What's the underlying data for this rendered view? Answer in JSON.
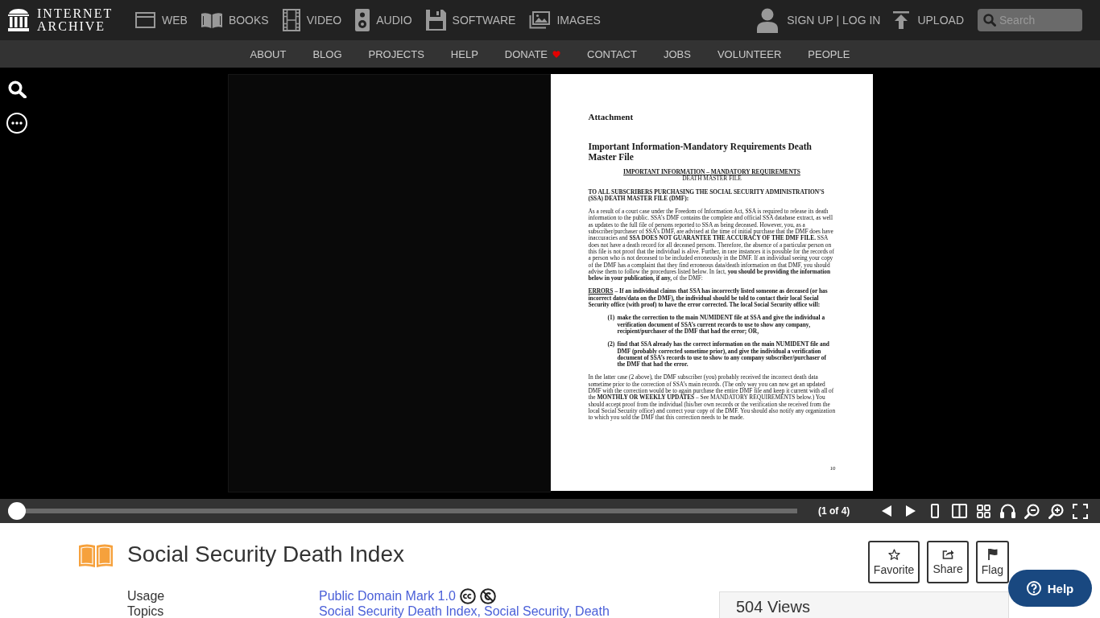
{
  "header": {
    "logo": "INTERNET ARCHIVE",
    "media": [
      {
        "kind": "web",
        "label": "WEB"
      },
      {
        "kind": "books",
        "label": "BOOKS"
      },
      {
        "kind": "video",
        "label": "VIDEO"
      },
      {
        "kind": "audio",
        "label": "AUDIO"
      },
      {
        "kind": "software",
        "label": "SOFTWARE"
      },
      {
        "kind": "images",
        "label": "IMAGES"
      }
    ],
    "account": "SIGN UP | LOG IN",
    "upload": "UPLOAD",
    "search": {
      "placeholder": "Search"
    }
  },
  "subnav": [
    {
      "kind": "plain",
      "label": "ABOUT"
    },
    {
      "kind": "plain",
      "label": "BLOG"
    },
    {
      "kind": "plain",
      "label": "PROJECTS"
    },
    {
      "kind": "plain",
      "label": "HELP"
    },
    {
      "kind": "donate",
      "label": "DONATE"
    },
    {
      "kind": "plain",
      "label": "CONTACT"
    },
    {
      "kind": "plain",
      "label": "JOBS"
    },
    {
      "kind": "plain",
      "label": "VOLUNTEER"
    },
    {
      "kind": "plain",
      "label": "PEOPLE"
    }
  ],
  "viewer": {
    "document_page": {
      "blocks": [
        {
          "kind": "title",
          "text": "Attachment"
        },
        {
          "kind": "heading",
          "text": "Important Information-Mandatory Requirements Death Master File"
        },
        {
          "kind": "underlined",
          "text": "IMPORTANT INFORMATION – MANDATORY REQUIREMENTS"
        },
        {
          "kind": "centered",
          "text": "DEATH MASTER FILE"
        },
        {
          "kind": "bold",
          "text": "TO ALL SUBSCRIBERS PURCHASING THE SOCIAL SECURITY ADMINISTRATION’S (SSA) DEATH MASTER FILE (DMF):"
        },
        {
          "kind": "paragraph",
          "text": "As a result of a court case under the Freedom of Information Act, SSA is required to release its death information to the public. SSA’s DMF contains the complete and official SSA database extract, as well as updates to the full file of persons reported to SSA as being deceased. However, you, as a subscriber/purchaser of SSA’s DMF, are advised at the time of initial purchase that the DMF does have inaccuracies and **SSA DOES NOT GUARANTEE THE ACCURACY OF THE DMF FILE.** SSA does not have a death record for all deceased persons. Therefore, the absence of a particular person on this file is not proof that the individual is alive. Further, in rare instances it is possible for the records of a person who is not deceased to be included erroneously in the DMF. If an individual seeing your copy of the DMF has a complaint that they find erroneous data/death information on that DMF, you should advise them to follow the procedures listed below. In fact, **you should be providing the information below in your publication, if any,** of the DMF:"
        },
        {
          "kind": "bold",
          "lead": "ERRORS",
          "text": "– If an individual claims that SSA has incorrectly listed someone as deceased (or has incorrect dates/data on the DMF), the individual should be told to contact their local Social Security office (with proof) to have the error corrected. The local Social Security office will:"
        },
        {
          "kind": "numbered",
          "number": "(1)",
          "text": "make the correction to the main NUMIDENT file at SSA and give the individual a verification document of SSA’s current records to use to show any company, recipient/purchaser of the DMF that had the error; OR,"
        },
        {
          "kind": "numbered",
          "number": "(2)",
          "text": "find that SSA already has the correct information on the main NUMIDENT file and DMF (probably corrected sometime prior), and give the individual a verification document of SSA’s records to use to show to any company subscriber/purchaser of the DMF that had the error."
        },
        {
          "kind": "paragraph",
          "text": "In the latter case (2 above), the DMF subscriber (you) probably received the incorrect death data sometime prior to the correction of SSA’s main records. (The only way you can now get an updated DMF with the correction would be to again purchase the entire DMF file and keep it current with all of the **MONTHLY OR WEEKLY UPDATES** – See MANDATORY REQUIREMENTS below.) You should accept proof from the individual (his/her own records or the verification she received from the local Social Security office) and correct your copy of the DMF. You should also notify any organization to which you sold the DMF that this correction needs to be made."
        },
        {
          "kind": "folio",
          "text": "10"
        }
      ]
    },
    "slider": {
      "level": 0
    },
    "page_counter": "(1 of 4)"
  },
  "item": {
    "title": "Social Security Death Index",
    "actions": [
      {
        "kind": "favorite",
        "label": "Favorite"
      },
      {
        "kind": "share",
        "label": "Share"
      },
      {
        "kind": "flag",
        "label": "Flag"
      }
    ],
    "metadata": [
      {
        "kind": "license",
        "label": "Usage",
        "values": [
          "Public Domain Mark 1.0"
        ]
      },
      {
        "kind": "topics",
        "label": "Topics",
        "values": [
          "Social Security Death Index,",
          "Social Security,",
          "Death"
        ]
      }
    ],
    "stats": {
      "views": "504 Views"
    }
  },
  "help_button": {
    "label": "Help"
  }
}
